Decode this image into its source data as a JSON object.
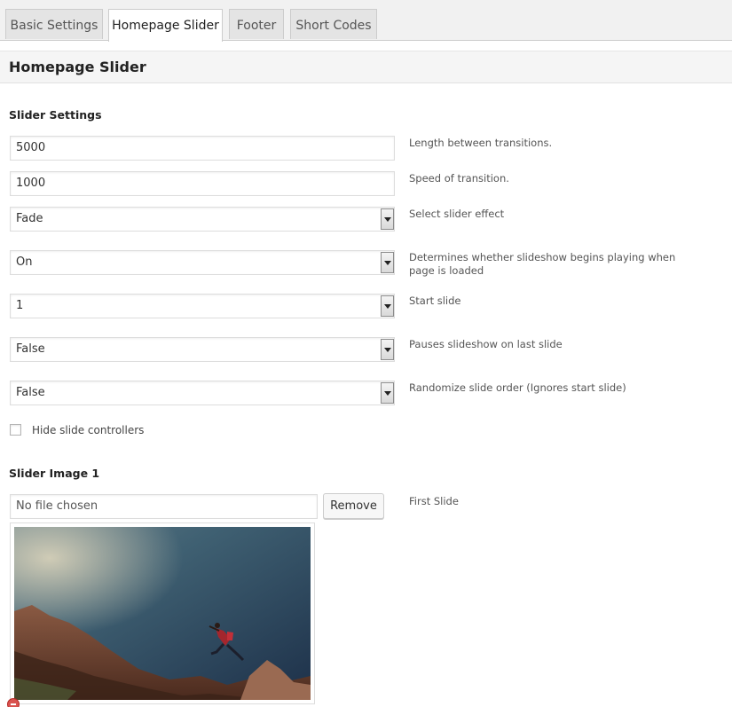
{
  "tabs": [
    {
      "label": "Basic Settings",
      "active": false
    },
    {
      "label": "Homepage Slider",
      "active": true
    },
    {
      "label": "Footer",
      "active": false
    },
    {
      "label": "Short Codes",
      "active": false
    }
  ],
  "section": {
    "title": "Homepage Slider"
  },
  "slider_settings": {
    "heading": "Slider Settings",
    "fields": [
      {
        "type": "text",
        "value": "5000",
        "description": "Length between transitions."
      },
      {
        "type": "text",
        "value": "1000",
        "description": "Speed of transition."
      },
      {
        "type": "select",
        "value": "Fade",
        "description": "Select slider effect"
      },
      {
        "type": "select",
        "value": "On",
        "description": "Determines whether slideshow begins playing when page is loaded"
      },
      {
        "type": "select",
        "value": "1",
        "description": "Start slide"
      },
      {
        "type": "select",
        "value": "False",
        "description": "Pauses slideshow on last slide"
      },
      {
        "type": "select",
        "value": "False",
        "description": "Randomize slide order (Ignores start slide)"
      }
    ],
    "checkbox": {
      "label": "Hide slide controllers",
      "checked": false
    }
  },
  "slider_image": {
    "heading": "Slider Image 1",
    "file_text": "No file chosen",
    "remove_label": "Remove",
    "description": "First Slide"
  },
  "colors": {
    "tab_active_bg": "#ffffff",
    "tab_inactive_bg": "#e4e4e4",
    "header_bg": "#f5f5f5",
    "remove_icon": "#d9534f"
  }
}
